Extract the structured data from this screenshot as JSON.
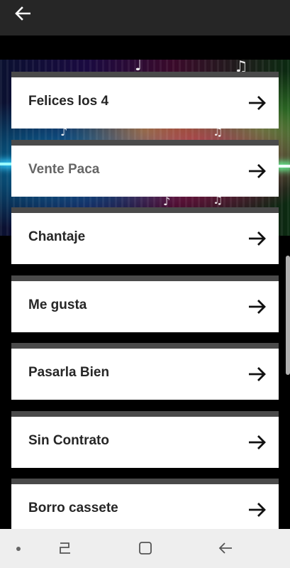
{
  "songs": [
    {
      "title": "Felices los 4"
    },
    {
      "title": "Vente Paca"
    },
    {
      "title": "Chantaje"
    },
    {
      "title": "Me gusta"
    },
    {
      "title": "Pasarla Bien"
    },
    {
      "title": "Sin Contrato"
    },
    {
      "title": "Borro cassete"
    }
  ],
  "icons": {
    "back": "arrow-left-icon",
    "item_arrow": "arrow-right-icon",
    "nav_recents": "recents-icon",
    "nav_home": "home-icon",
    "nav_back": "nav-back-icon"
  },
  "colors": {
    "appbar": "#262626",
    "item_bar": "#4a4a4a",
    "item_bg": "#ffffff",
    "text": "#262626"
  }
}
